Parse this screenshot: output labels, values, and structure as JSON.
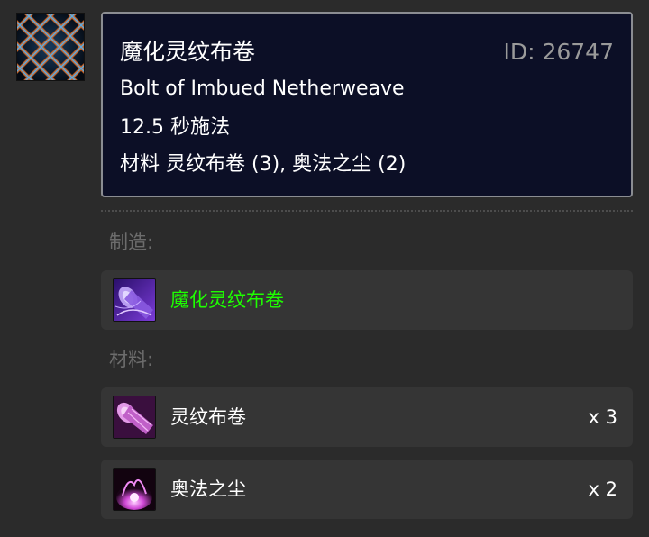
{
  "spell": {
    "icon": "imbued-netherweave-net-icon",
    "name_zh": "魔化灵纹布卷",
    "id_label": "ID: 26747",
    "name_en": "Bolt of Imbued Netherweave",
    "cast_time": "12.5 秒施法",
    "reagents_line": "材料 灵纹布卷 (3), 奥法之尘 (2)"
  },
  "creates": {
    "label": "制造:",
    "item": {
      "name": "魔化灵纹布卷",
      "icon": "imbued-netherweave-bolt-icon",
      "color": "#1eff00"
    }
  },
  "materials": {
    "label": "材料:",
    "items": [
      {
        "name": "灵纹布卷",
        "qty": "x 3",
        "icon": "netherweave-bolt-icon"
      },
      {
        "name": "奥法之尘",
        "qty": "x 2",
        "icon": "arcane-dust-icon"
      }
    ]
  },
  "colors": {
    "background": "#2b2b2b",
    "tooltip_bg": "#0c0f26",
    "tooltip_border": "#8b8d92",
    "uncommon_item": "#1eff00",
    "muted_text": "#6c6c6c"
  }
}
